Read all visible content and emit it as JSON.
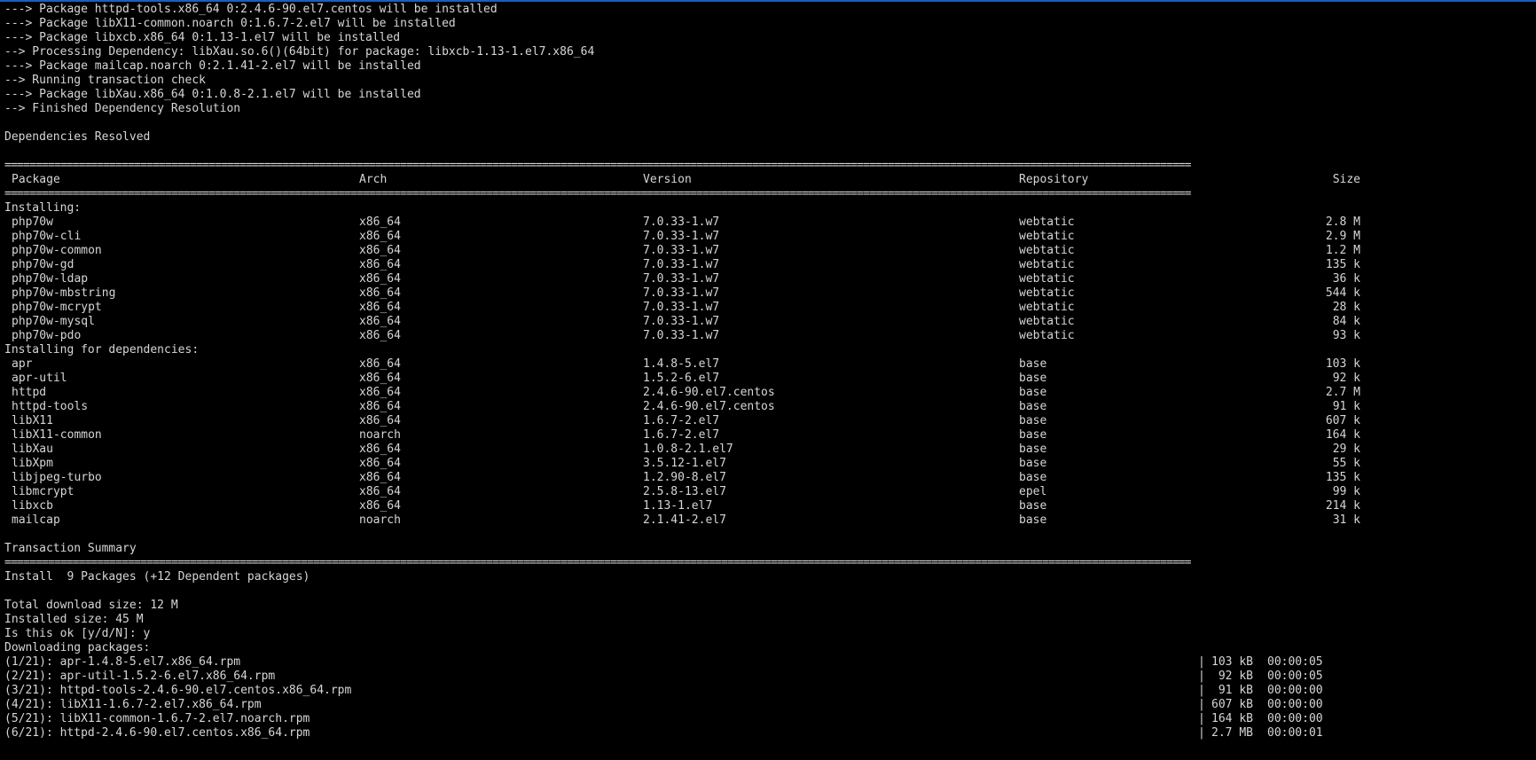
{
  "terminal": {
    "pre_lines": [
      "---> Package httpd-tools.x86_64 0:2.4.6-90.el7.centos will be installed",
      "---> Package libX11-common.noarch 0:1.6.7-2.el7 will be installed",
      "---> Package libxcb.x86_64 0:1.13-1.el7 will be installed",
      "--> Processing Dependency: libXau.so.6()(64bit) for package: libxcb-1.13-1.el7.x86_64",
      "---> Package mailcap.noarch 0:2.1.41-2.el7 will be installed",
      "--> Running transaction check",
      "---> Package libXau.x86_64 0:1.0.8-2.1.el7 will be installed",
      "--> Finished Dependency Resolution"
    ],
    "resolved": "Dependencies Resolved",
    "rule": "================================================================================================================================================================================================",
    "header": {
      "package": "Package",
      "arch": "Arch",
      "version": "Version",
      "repository": "Repository",
      "size": "Size"
    },
    "installing_label": "Installing:",
    "installing": [
      {
        "package": "php70w",
        "arch": "x86_64",
        "version": "7.0.33-1.w7",
        "repository": "webtatic",
        "size": "2.8 M"
      },
      {
        "package": "php70w-cli",
        "arch": "x86_64",
        "version": "7.0.33-1.w7",
        "repository": "webtatic",
        "size": "2.9 M"
      },
      {
        "package": "php70w-common",
        "arch": "x86_64",
        "version": "7.0.33-1.w7",
        "repository": "webtatic",
        "size": "1.2 M"
      },
      {
        "package": "php70w-gd",
        "arch": "x86_64",
        "version": "7.0.33-1.w7",
        "repository": "webtatic",
        "size": "135 k"
      },
      {
        "package": "php70w-ldap",
        "arch": "x86_64",
        "version": "7.0.33-1.w7",
        "repository": "webtatic",
        "size": "36 k"
      },
      {
        "package": "php70w-mbstring",
        "arch": "x86_64",
        "version": "7.0.33-1.w7",
        "repository": "webtatic",
        "size": "544 k"
      },
      {
        "package": "php70w-mcrypt",
        "arch": "x86_64",
        "version": "7.0.33-1.w7",
        "repository": "webtatic",
        "size": "28 k"
      },
      {
        "package": "php70w-mysql",
        "arch": "x86_64",
        "version": "7.0.33-1.w7",
        "repository": "webtatic",
        "size": "84 k"
      },
      {
        "package": "php70w-pdo",
        "arch": "x86_64",
        "version": "7.0.33-1.w7",
        "repository": "webtatic",
        "size": "93 k"
      }
    ],
    "deps_label": "Installing for dependencies:",
    "dependencies": [
      {
        "package": "apr",
        "arch": "x86_64",
        "version": "1.4.8-5.el7",
        "repository": "base",
        "size": "103 k"
      },
      {
        "package": "apr-util",
        "arch": "x86_64",
        "version": "1.5.2-6.el7",
        "repository": "base",
        "size": "92 k"
      },
      {
        "package": "httpd",
        "arch": "x86_64",
        "version": "2.4.6-90.el7.centos",
        "repository": "base",
        "size": "2.7 M"
      },
      {
        "package": "httpd-tools",
        "arch": "x86_64",
        "version": "2.4.6-90.el7.centos",
        "repository": "base",
        "size": "91 k"
      },
      {
        "package": "libX11",
        "arch": "x86_64",
        "version": "1.6.7-2.el7",
        "repository": "base",
        "size": "607 k"
      },
      {
        "package": "libX11-common",
        "arch": "noarch",
        "version": "1.6.7-2.el7",
        "repository": "base",
        "size": "164 k"
      },
      {
        "package": "libXau",
        "arch": "x86_64",
        "version": "1.0.8-2.1.el7",
        "repository": "base",
        "size": "29 k"
      },
      {
        "package": "libXpm",
        "arch": "x86_64",
        "version": "3.5.12-1.el7",
        "repository": "base",
        "size": "55 k"
      },
      {
        "package": "libjpeg-turbo",
        "arch": "x86_64",
        "version": "1.2.90-8.el7",
        "repository": "base",
        "size": "135 k"
      },
      {
        "package": "libmcrypt",
        "arch": "x86_64",
        "version": "2.5.8-13.el7",
        "repository": "epel",
        "size": "99 k"
      },
      {
        "package": "libxcb",
        "arch": "x86_64",
        "version": "1.13-1.el7",
        "repository": "base",
        "size": "214 k"
      },
      {
        "package": "mailcap",
        "arch": "noarch",
        "version": "2.1.41-2.el7",
        "repository": "base",
        "size": "31 k"
      }
    ],
    "summary_title": "Transaction Summary",
    "install_line": "Install  9 Packages (+12 Dependent packages)",
    "download_size": "Total download size: 12 M",
    "installed_size": "Installed size: 45 M",
    "prompt": "Is this ok [y/d/N]: y",
    "downloading": "Downloading packages:",
    "downloads": [
      {
        "name": "(1/21): apr-1.4.8-5.el7.x86_64.rpm",
        "size": "103 kB",
        "time": "00:00:05"
      },
      {
        "name": "(2/21): apr-util-1.5.2-6.el7.x86_64.rpm",
        "size": "92 kB",
        "time": "00:00:05"
      },
      {
        "name": "(3/21): httpd-tools-2.4.6-90.el7.centos.x86_64.rpm",
        "size": "91 kB",
        "time": "00:00:00"
      },
      {
        "name": "(4/21): libX11-1.6.7-2.el7.x86_64.rpm",
        "size": "607 kB",
        "time": "00:00:00"
      },
      {
        "name": "(5/21): libX11-common-1.6.7-2.el7.noarch.rpm",
        "size": "164 kB",
        "time": "00:00:00"
      },
      {
        "name": "(6/21): httpd-2.4.6-90.el7.centos.x86_64.rpm",
        "size": "2.7 MB",
        "time": "00:00:01"
      }
    ],
    "separator": "|"
  }
}
